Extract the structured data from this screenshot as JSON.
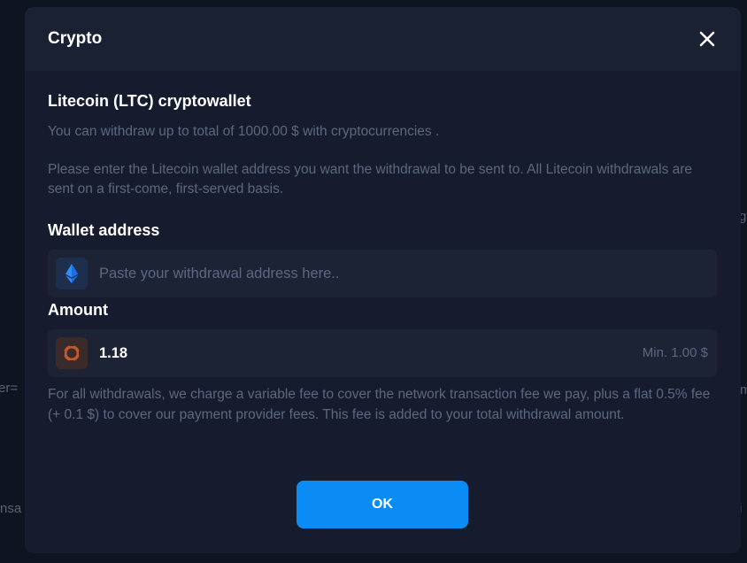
{
  "background": {
    "fragments": [
      "er=",
      "nsa",
      "g",
      "m",
      "i"
    ]
  },
  "modal": {
    "title": "Crypto",
    "close_icon": "close-icon",
    "wallet_heading": "Litecoin (LTC) cryptowallet",
    "limit_text": "You can withdraw up to total of 1000.00 $ with cryptocurrencies .",
    "instruction_text": "Please enter the Litecoin wallet address you want the withdrawal to be sent to. All Litecoin withdrawals are sent on a first-come, first-served basis.",
    "wallet_label": "Wallet address",
    "wallet_input": {
      "icon": "ethereum-icon",
      "placeholder": "Paste your withdrawal address here..",
      "value": ""
    },
    "amount_label": "Amount",
    "amount_input": {
      "icon": "coin-icon",
      "value": "1.18",
      "min_label": "Min. 1.00 $"
    },
    "fee_note": "For all withdrawals, we charge a variable fee to cover the network transaction fee we pay, plus a flat 0.5% fee (+ 0.1 $) to cover our payment provider fees. This fee is added to your total withdrawal amount.",
    "ok_label": "OK"
  },
  "colors": {
    "accent": "#0b8cf5",
    "modal_bg": "#161c2d",
    "field_bg": "#1c2335",
    "muted_text": "#5d6780"
  }
}
